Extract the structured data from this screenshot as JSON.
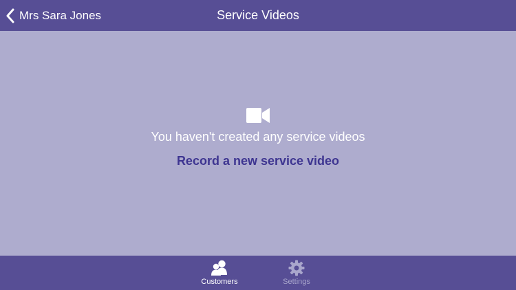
{
  "colors": {
    "nav_background": "#574e95",
    "content_background": "#aeacce",
    "link_color": "#3e3591",
    "tab_inactive": "#a9a6cc",
    "tab_active": "#ffffff"
  },
  "nav": {
    "back_icon": "chevron-left-icon",
    "back_label": "Mrs Sara Jones",
    "title": "Service Videos"
  },
  "empty_state": {
    "icon": "video-camera-icon",
    "message": "You haven't created any service videos",
    "action_label": "Record a new service video"
  },
  "tab_bar": {
    "tabs": [
      {
        "label": "Customers",
        "icon": "customers-icon",
        "selected": true
      },
      {
        "label": "Settings",
        "icon": "gear-icon",
        "selected": false
      }
    ]
  }
}
